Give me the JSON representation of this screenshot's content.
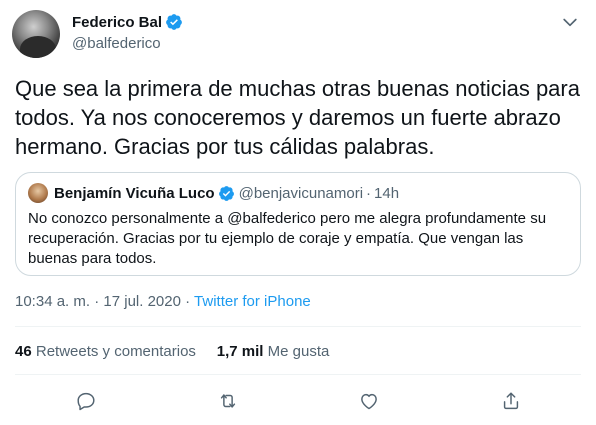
{
  "author": {
    "display_name": "Federico Bal",
    "handle": "@balfederico"
  },
  "tweet": {
    "text": "Que sea la primera de muchas otras buenas noticias para todos. Ya nos conoceremos y daremos un fuerte abrazo hermano. Gracias por tus cálidas palabras."
  },
  "quote": {
    "display_name": "Benjamín Vicuña Luco",
    "handle": "@benjavicunamori",
    "separator": "·",
    "time": "14h",
    "text": "No conozco personalmente a @balfederico pero me alegra profundamente su recuperación. Gracias por tu ejemplo de coraje y empatía. Que vengan las buenas para todos."
  },
  "meta": {
    "time": "10:34 a. m.",
    "sep1": "·",
    "date": "17 jul. 2020",
    "sep2": "·",
    "source": "Twitter for iPhone"
  },
  "stats": {
    "retweets_count": "46",
    "retweets_label": "Retweets y comentarios",
    "likes_count": "1,7 mil",
    "likes_label": "Me gusta"
  },
  "colors": {
    "accent": "#1d9bf0",
    "secondary_text": "#536471",
    "border": "#cfd9de"
  },
  "icons": {
    "verified": "verified-badge-icon",
    "caret": "chevron-down-icon",
    "reply": "reply-icon",
    "retweet": "retweet-icon",
    "like": "heart-icon",
    "share": "share-icon"
  }
}
